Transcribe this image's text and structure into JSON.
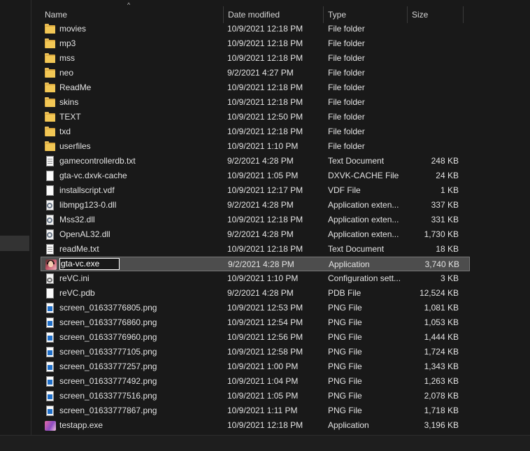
{
  "columns": {
    "name": "Name",
    "date": "Date modified",
    "type": "Type",
    "size": "Size"
  },
  "sort_glyph": "^",
  "files": [
    {
      "name": "movies",
      "date": "10/9/2021 12:18 PM",
      "type": "File folder",
      "size": "",
      "icon": "folder-icon"
    },
    {
      "name": "mp3",
      "date": "10/9/2021 12:18 PM",
      "type": "File folder",
      "size": "",
      "icon": "folder-icon"
    },
    {
      "name": "mss",
      "date": "10/9/2021 12:18 PM",
      "type": "File folder",
      "size": "",
      "icon": "folder-icon"
    },
    {
      "name": "neo",
      "date": "9/2/2021 4:27 PM",
      "type": "File folder",
      "size": "",
      "icon": "folder-icon"
    },
    {
      "name": "ReadMe",
      "date": "10/9/2021 12:18 PM",
      "type": "File folder",
      "size": "",
      "icon": "folder-icon"
    },
    {
      "name": "skins",
      "date": "10/9/2021 12:18 PM",
      "type": "File folder",
      "size": "",
      "icon": "folder-icon"
    },
    {
      "name": "TEXT",
      "date": "10/9/2021 12:50 PM",
      "type": "File folder",
      "size": "",
      "icon": "folder-icon"
    },
    {
      "name": "txd",
      "date": "10/9/2021 12:18 PM",
      "type": "File folder",
      "size": "",
      "icon": "folder-icon"
    },
    {
      "name": "userfiles",
      "date": "10/9/2021 1:10 PM",
      "type": "File folder",
      "size": "",
      "icon": "folder-icon"
    },
    {
      "name": "gamecontrollerdb.txt",
      "date": "9/2/2021 4:28 PM",
      "type": "Text Document",
      "size": "248 KB",
      "icon": "text-document-icon"
    },
    {
      "name": "gta-vc.dxvk-cache",
      "date": "10/9/2021 1:05 PM",
      "type": "DXVK-CACHE File",
      "size": "24 KB",
      "icon": "blank-file-icon"
    },
    {
      "name": "installscript.vdf",
      "date": "10/9/2021 12:17 PM",
      "type": "VDF File",
      "size": "1 KB",
      "icon": "blank-file-icon"
    },
    {
      "name": "libmpg123-0.dll",
      "date": "9/2/2021 4:28 PM",
      "type": "Application exten...",
      "size": "337 KB",
      "icon": "dll-icon"
    },
    {
      "name": "Mss32.dll",
      "date": "10/9/2021 12:18 PM",
      "type": "Application exten...",
      "size": "331 KB",
      "icon": "dll-icon"
    },
    {
      "name": "OpenAL32.dll",
      "date": "9/2/2021 4:28 PM",
      "type": "Application exten...",
      "size": "1,730 KB",
      "icon": "dll-icon"
    },
    {
      "name": "readMe.txt",
      "date": "10/9/2021 12:18 PM",
      "type": "Text Document",
      "size": "18 KB",
      "icon": "text-document-icon"
    },
    {
      "name": "gta-vc.exe",
      "date": "9/2/2021 4:28 PM",
      "type": "Application",
      "size": "3,740 KB",
      "icon": "application-icon",
      "selected": true,
      "renaming": true
    },
    {
      "name": "reVC.ini",
      "date": "10/9/2021 1:10 PM",
      "type": "Configuration sett...",
      "size": "3 KB",
      "icon": "config-file-icon"
    },
    {
      "name": "reVC.pdb",
      "date": "9/2/2021 4:28 PM",
      "type": "PDB File",
      "size": "12,524 KB",
      "icon": "blank-file-icon"
    },
    {
      "name": "screen_01633776805.png",
      "date": "10/9/2021 12:53 PM",
      "type": "PNG File",
      "size": "1,081 KB",
      "icon": "png-image-icon"
    },
    {
      "name": "screen_01633776860.png",
      "date": "10/9/2021 12:54 PM",
      "type": "PNG File",
      "size": "1,053 KB",
      "icon": "png-image-icon"
    },
    {
      "name": "screen_01633776960.png",
      "date": "10/9/2021 12:56 PM",
      "type": "PNG File",
      "size": "1,444 KB",
      "icon": "png-image-icon"
    },
    {
      "name": "screen_01633777105.png",
      "date": "10/9/2021 12:58 PM",
      "type": "PNG File",
      "size": "1,724 KB",
      "icon": "png-image-icon"
    },
    {
      "name": "screen_01633777257.png",
      "date": "10/9/2021 1:00 PM",
      "type": "PNG File",
      "size": "1,343 KB",
      "icon": "png-image-icon"
    },
    {
      "name": "screen_01633777492.png",
      "date": "10/9/2021 1:04 PM",
      "type": "PNG File",
      "size": "1,263 KB",
      "icon": "png-image-icon"
    },
    {
      "name": "screen_01633777516.png",
      "date": "10/9/2021 1:05 PM",
      "type": "PNG File",
      "size": "2,078 KB",
      "icon": "png-image-icon"
    },
    {
      "name": "screen_01633777867.png",
      "date": "10/9/2021 1:11 PM",
      "type": "PNG File",
      "size": "1,718 KB",
      "icon": "png-image-icon"
    },
    {
      "name": "testapp.exe",
      "date": "10/9/2021 12:18 PM",
      "type": "Application",
      "size": "3,196 KB",
      "icon": "testapp-application-icon"
    }
  ],
  "colors": {
    "background": "#191919",
    "selected_row": "#4d4d4d",
    "folder": "#f2c755",
    "text": "#e3e3e3"
  }
}
